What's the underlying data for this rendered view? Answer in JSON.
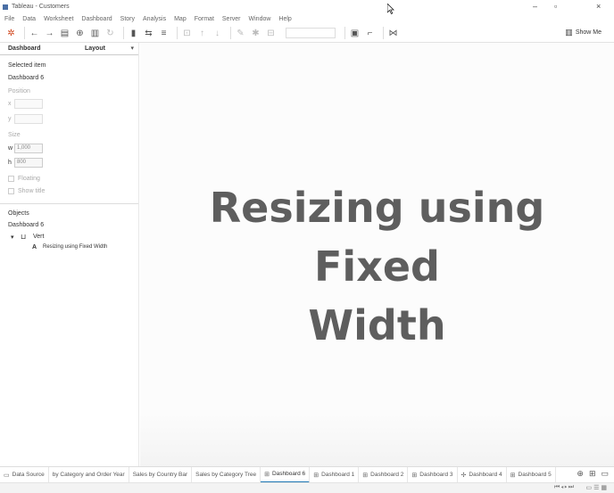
{
  "window": {
    "title": "Tableau - Customers",
    "minimize_glyph": "–",
    "restore_glyph": "▫",
    "close_glyph": "×"
  },
  "menu": [
    "File",
    "Data",
    "Worksheet",
    "Dashboard",
    "Story",
    "Analysis",
    "Map",
    "Format",
    "Server",
    "Window",
    "Help"
  ],
  "toolbar": {
    "show_me_label": "Show Me"
  },
  "left_panel": {
    "tabs": {
      "dashboard": "Dashboard",
      "layout": "Layout"
    },
    "selected_item_heading": "Selected item",
    "selected_item_value": "Dashboard 6",
    "position_heading": "Position",
    "x_label": "x",
    "y_label": "y",
    "size_heading": "Size",
    "w_label": "w",
    "w_value": "1,000",
    "h_label": "h",
    "h_value": "800",
    "floating_label": "Floating",
    "show_title_label": "Show title",
    "objects_heading": "Objects",
    "tree_root": "Dashboard 6",
    "tree_child": "Vert",
    "tree_leaf": "Resizing using Fixed Width"
  },
  "overlay": {
    "line1": "Resizing using Fixed",
    "line2": "Width"
  },
  "sheet_tabs": [
    {
      "label": "Data Source",
      "icon": "data-source-icon",
      "glyph": "▭",
      "active": false
    },
    {
      "label": "by Category and Order Year",
      "icon": "",
      "glyph": "",
      "active": false
    },
    {
      "label": "Sales by Country Bar",
      "icon": "",
      "glyph": "",
      "active": false
    },
    {
      "label": "Sales by Category Tree",
      "icon": "",
      "glyph": "",
      "active": false
    },
    {
      "label": "Dashboard 6",
      "icon": "dashboard-icon",
      "glyph": "⊞",
      "active": true
    },
    {
      "label": "Dashboard 1",
      "icon": "dashboard-icon",
      "glyph": "⊞",
      "active": false
    },
    {
      "label": "Dashboard 2",
      "icon": "dashboard-icon",
      "glyph": "⊞",
      "active": false
    },
    {
      "label": "Dashboard 3",
      "icon": "dashboard-icon",
      "glyph": "⊞",
      "active": false
    },
    {
      "label": "Dashboard 4",
      "icon": "dashboard-icon",
      "glyph": "✢",
      "active": false
    },
    {
      "label": "Dashboard 5",
      "icon": "dashboard-icon",
      "glyph": "⊞",
      "active": false
    }
  ],
  "colors": {
    "accent": "#1f77b4",
    "overlay_text": "#5e5e5e"
  }
}
